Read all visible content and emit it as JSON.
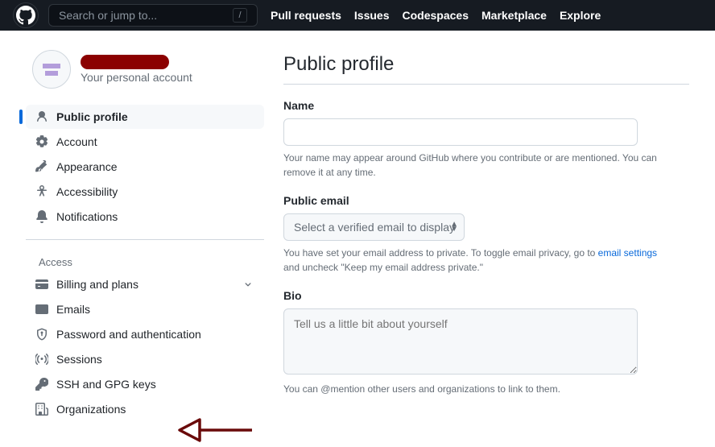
{
  "header": {
    "search_placeholder": "Search or jump to...",
    "nav": [
      "Pull requests",
      "Issues",
      "Codespaces",
      "Marketplace",
      "Explore"
    ]
  },
  "account": {
    "subtitle": "Your personal account"
  },
  "sidebar": {
    "main": [
      "Public profile",
      "Account",
      "Appearance",
      "Accessibility",
      "Notifications"
    ],
    "access_title": "Access",
    "access": [
      "Billing and plans",
      "Emails",
      "Password and authentication",
      "Sessions",
      "SSH and GPG keys",
      "Organizations"
    ]
  },
  "profile": {
    "title": "Public profile",
    "name_label": "Name",
    "name_note": "Your name may appear around GitHub where you contribute or are mentioned. You can remove it at any time.",
    "email_label": "Public email",
    "email_select": "Select a verified email to display",
    "email_note_pre": "You have set your email address to private. To toggle email privacy, go to ",
    "email_note_link": "email settings",
    "email_note_post": " and uncheck \"Keep my email address private.\"",
    "bio_label": "Bio",
    "bio_placeholder": "Tell us a little bit about yourself",
    "bio_note": "You can @mention other users and organizations to link to them."
  }
}
